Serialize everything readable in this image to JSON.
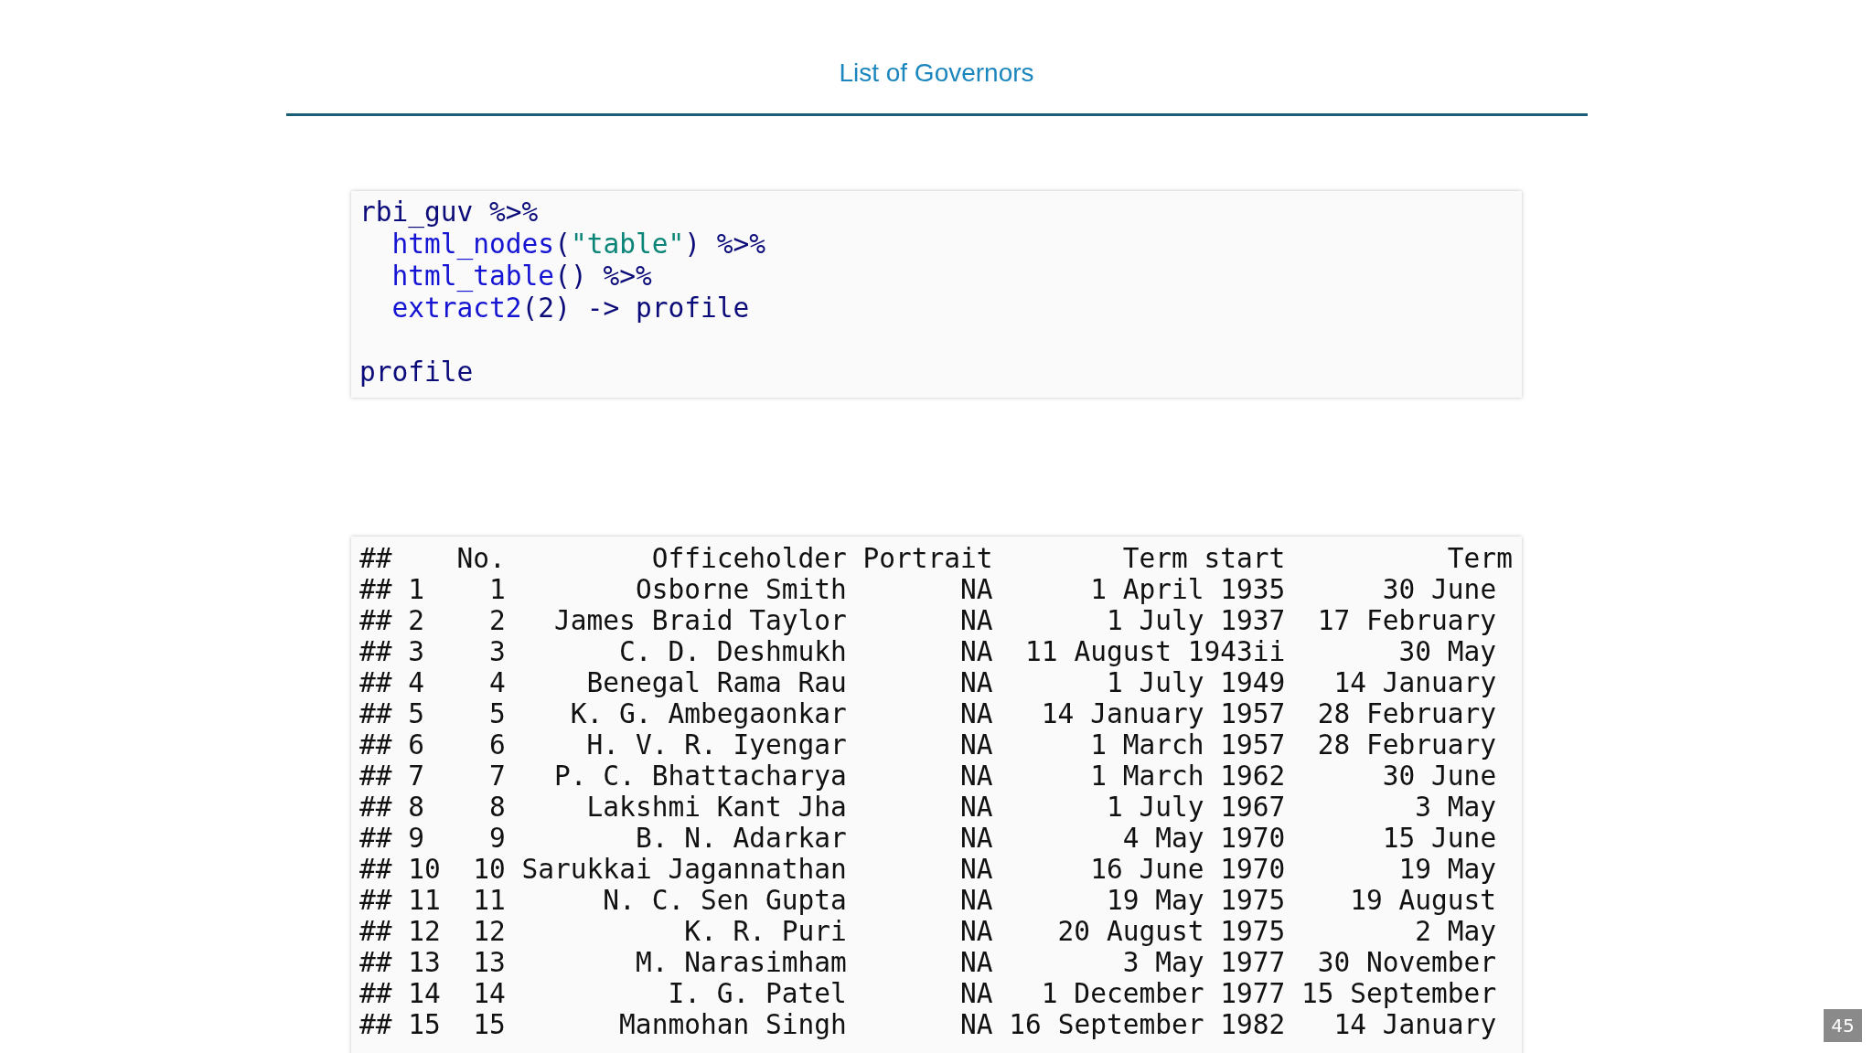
{
  "slide": {
    "title": "List of Governors",
    "page_number": "45"
  },
  "code": {
    "blocks": [
      {
        "lines": [
          {
            "indented": false,
            "tokens": [
              {
                "text": "rbi_guv %>%",
                "kind": "plain"
              }
            ]
          },
          {
            "indented": true,
            "tokens": [
              {
                "text": "html_nodes",
                "kind": "function"
              },
              {
                "text": "(",
                "kind": "plain"
              },
              {
                "text": "\"table\"",
                "kind": "string"
              },
              {
                "text": ") %>%",
                "kind": "plain"
              }
            ]
          },
          {
            "indented": true,
            "tokens": [
              {
                "text": "html_table",
                "kind": "function"
              },
              {
                "text": "() %>%",
                "kind": "plain"
              }
            ]
          },
          {
            "indented": true,
            "tokens": [
              {
                "text": "extract2",
                "kind": "function"
              },
              {
                "text": "(2) -> profile",
                "kind": "plain"
              }
            ]
          }
        ]
      },
      {
        "lines": [
          {
            "indented": false,
            "tokens": [
              {
                "text": "profile",
                "kind": "plain"
              }
            ]
          }
        ]
      }
    ]
  },
  "output": {
    "prefix": "##",
    "columns": [
      "No.",
      "Officeholder",
      "Portrait",
      "Term start",
      "Term"
    ],
    "rows": [
      {
        "prefix": "##",
        "row": "1",
        "cells": [
          "1",
          "Osborne Smith",
          "NA",
          "1 April 1935",
          "30 June"
        ]
      },
      {
        "prefix": "##",
        "row": "2",
        "cells": [
          "2",
          "James Braid Taylor",
          "NA",
          "1 July 1937",
          "17 February"
        ]
      },
      {
        "prefix": "##",
        "row": "3",
        "cells": [
          "3",
          "C. D. Deshmukh",
          "NA",
          "11 August 1943ii",
          "30 May"
        ]
      },
      {
        "prefix": "##",
        "row": "4",
        "cells": [
          "4",
          "Benegal Rama Rau",
          "NA",
          "1 July 1949",
          "14 January"
        ]
      },
      {
        "prefix": "##",
        "row": "5",
        "cells": [
          "5",
          "K. G. Ambegaonkar",
          "NA",
          "14 January 1957",
          "28 February"
        ]
      },
      {
        "prefix": "##",
        "row": "6",
        "cells": [
          "6",
          "H. V. R. Iyengar",
          "NA",
          "1 March 1957",
          "28 February"
        ]
      },
      {
        "prefix": "##",
        "row": "7",
        "cells": [
          "7",
          "P. C. Bhattacharya",
          "NA",
          "1 March 1962",
          "30 June"
        ]
      },
      {
        "prefix": "##",
        "row": "8",
        "cells": [
          "8",
          "Lakshmi Kant Jha",
          "NA",
          "1 July 1967",
          "3 May"
        ]
      },
      {
        "prefix": "##",
        "row": "9",
        "cells": [
          "9",
          "B. N. Adarkar",
          "NA",
          "4 May 1970",
          "15 June"
        ]
      },
      {
        "prefix": "##",
        "row": "10",
        "cells": [
          "10",
          "Sarukkai Jagannathan",
          "NA",
          "16 June 1970",
          "19 May"
        ]
      },
      {
        "prefix": "##",
        "row": "11",
        "cells": [
          "11",
          "N. C. Sen Gupta",
          "NA",
          "19 May 1975",
          "19 August"
        ]
      },
      {
        "prefix": "##",
        "row": "12",
        "cells": [
          "12",
          "K. R. Puri",
          "NA",
          "20 August 1975",
          "2 May"
        ]
      },
      {
        "prefix": "##",
        "row": "13",
        "cells": [
          "13",
          "M. Narasimham",
          "NA",
          "3 May 1977",
          "30 November"
        ]
      },
      {
        "prefix": "##",
        "row": "14",
        "cells": [
          "14",
          "I. G. Patel",
          "NA",
          "1 December 1977",
          "15 September"
        ]
      },
      {
        "prefix": "##",
        "row": "15",
        "cells": [
          "15",
          "Manmohan Singh",
          "NA",
          "16 September 1982",
          "14 January"
        ]
      }
    ]
  }
}
